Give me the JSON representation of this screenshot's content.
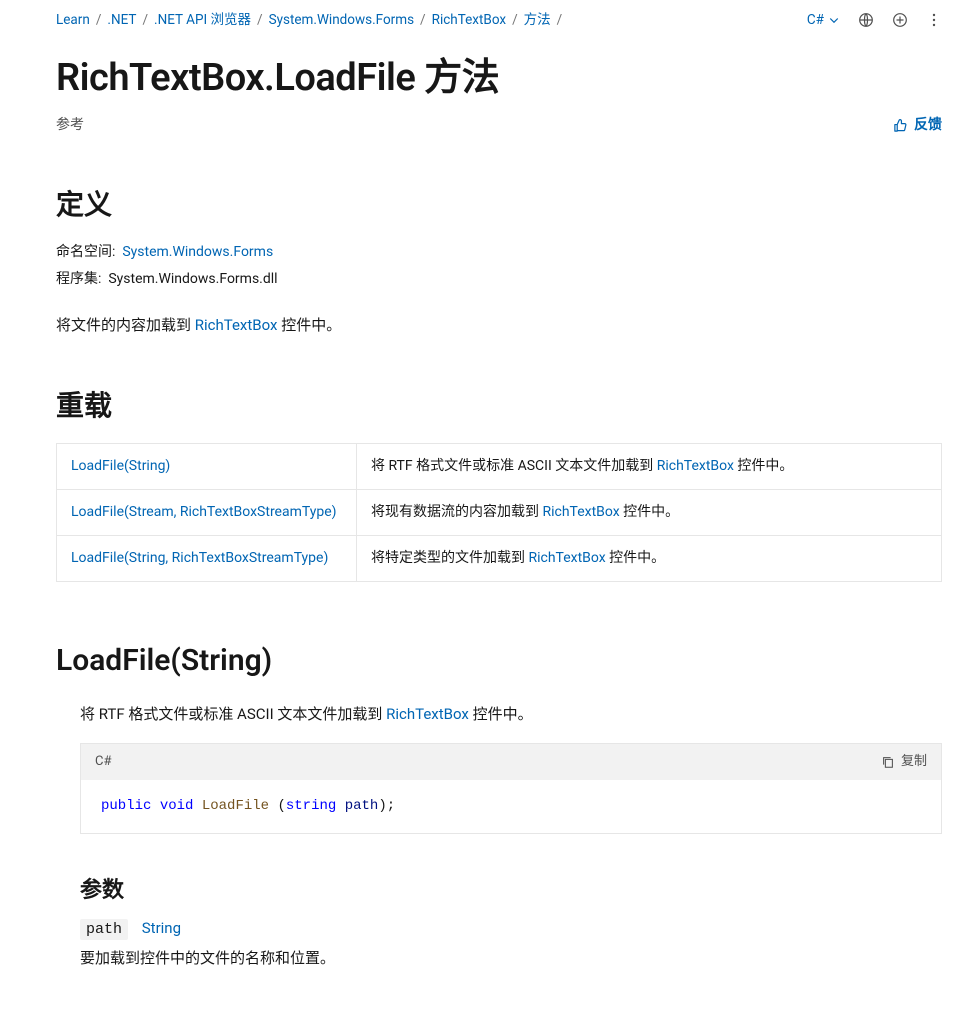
{
  "breadcrumb": {
    "items": {
      "0": "Learn",
      "1": ".NET",
      "2": ".NET API 浏览器",
      "3": "System.Windows.Forms",
      "4": "RichTextBox",
      "5": "方法"
    }
  },
  "topbar": {
    "lang_label": "C#",
    "feedback_label": "反馈"
  },
  "page": {
    "title": "RichTextBox.LoadFile 方法",
    "ref_label": "参考"
  },
  "definition": {
    "heading": "定义",
    "namespace_label": "命名空间:",
    "namespace_value": "System.Windows.Forms",
    "assembly_label": "程序集:",
    "assembly_value": "System.Windows.Forms.dll",
    "desc_pre": "将文件的内容加载到 ",
    "desc_link": "RichTextBox",
    "desc_post": " 控件中。"
  },
  "overloads": {
    "heading": "重载",
    "rows": {
      "0": {
        "link": "LoadFile(String)",
        "desc_pre": "将 RTF 格式文件或标准 ASCII 文本文件加载到 ",
        "desc_link": "RichTextBox",
        "desc_post": " 控件中。"
      },
      "1": {
        "link": "LoadFile(Stream, RichTextBoxStreamType)",
        "desc_pre": "将现有数据流的内容加载到 ",
        "desc_link": "RichTextBox",
        "desc_post": " 控件中。"
      },
      "2": {
        "link": "LoadFile(String, RichTextBoxStreamType)",
        "desc_pre": "将特定类型的文件加载到 ",
        "desc_link": "RichTextBox",
        "desc_post": " 控件中。"
      }
    }
  },
  "method1": {
    "heading": "LoadFile(String)",
    "desc_pre": "将 RTF 格式文件或标准 ASCII 文本文件加载到 ",
    "desc_link": "RichTextBox",
    "desc_post": " 控件中。",
    "code_lang": "C#",
    "copy_label": "复制",
    "code": {
      "kw_public": "public",
      "kw_void": "void",
      "fn": "LoadFile",
      "paren_open": " (",
      "typ": "string",
      "id": " path",
      "paren_close": ");"
    },
    "params_heading": "参数",
    "param_name": "path",
    "param_type": "String",
    "param_desc": "要加载到控件中的文件的名称和位置。"
  }
}
